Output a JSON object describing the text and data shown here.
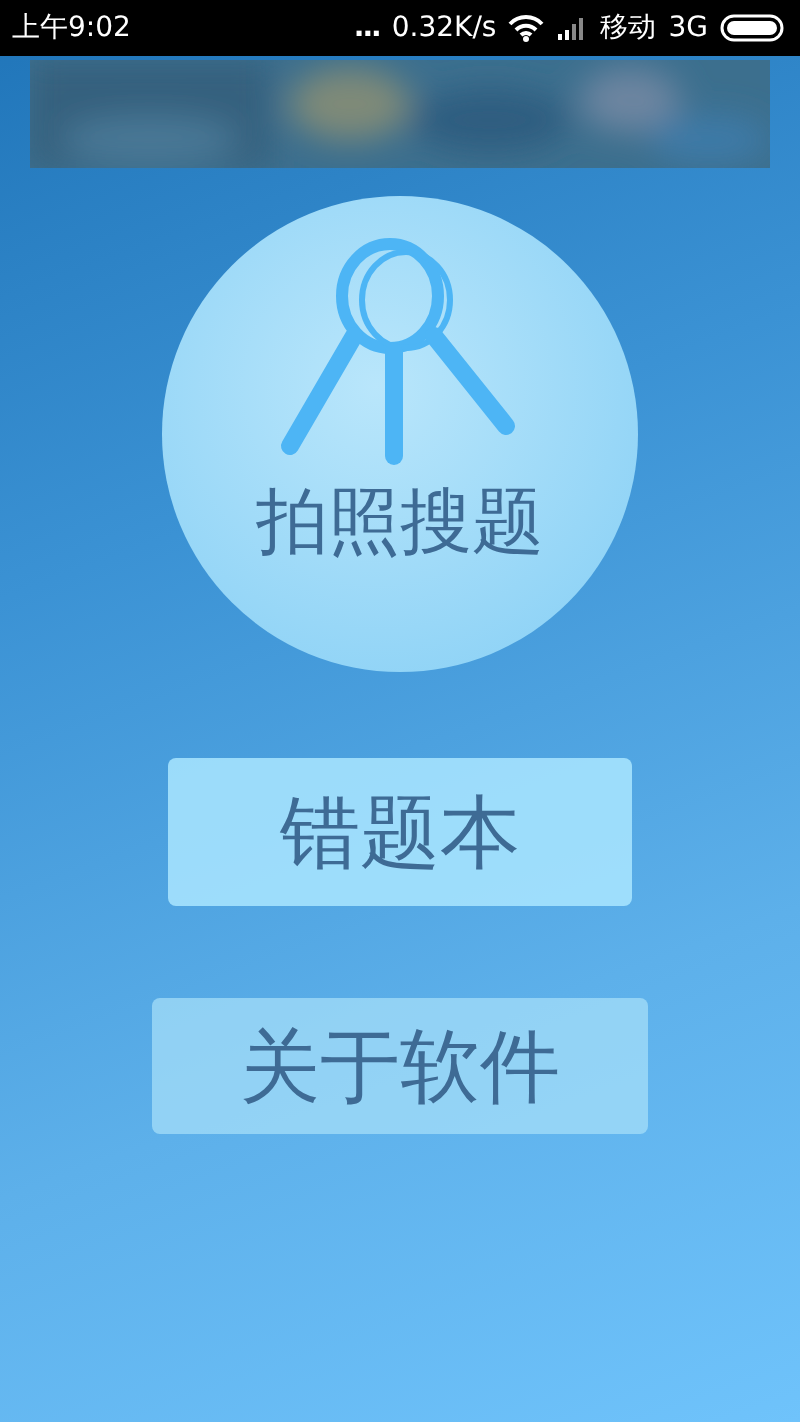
{
  "status_bar": {
    "time": "上午9:02",
    "dots": "...",
    "speed": "0.32K/s",
    "carrier": "移动",
    "network": "3G"
  },
  "main_button": {
    "label": "拍照搜题"
  },
  "buttons": [
    {
      "label": "错题本"
    },
    {
      "label": "关于软件"
    }
  ]
}
